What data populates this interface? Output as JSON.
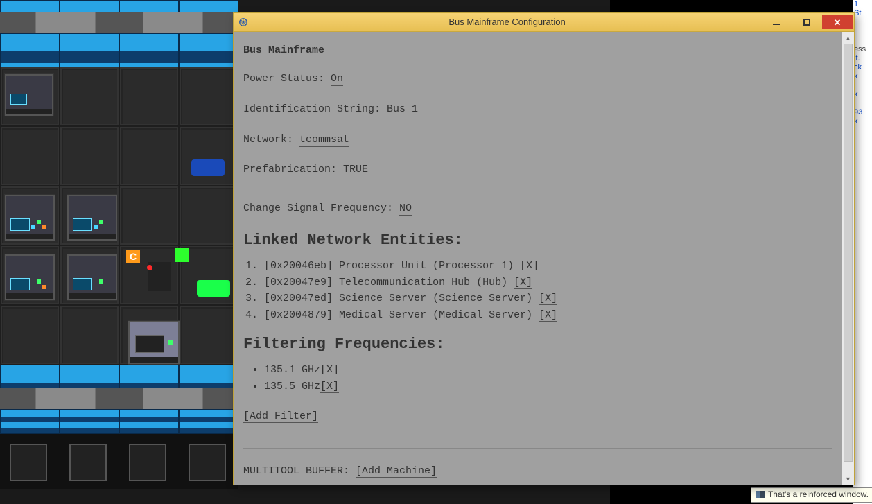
{
  "window": {
    "title": "Bus Mainframe Configuration",
    "heading": "Bus Mainframe"
  },
  "fields": {
    "power_label": "Power Status: ",
    "power_value": "On",
    "id_label": "Identification String: ",
    "id_value": "Bus 1",
    "network_label": "Network: ",
    "network_value": "tcommsat",
    "prefab_label": "Prefabrication: ",
    "prefab_value": "TRUE",
    "change_signal_label": "Change Signal Frequency: ",
    "change_signal_value": "NO"
  },
  "sections": {
    "linked_title": "Linked Network Entities:",
    "filter_title": "Filtering Frequencies:",
    "multitool_label": "MULTITOOL BUFFER: "
  },
  "entities": [
    {
      "hex": "[0x20046eb]",
      "desc": "Processor Unit (Processor 1)",
      "x": "[X]"
    },
    {
      "hex": "[0x20047e9]",
      "desc": "Telecommunication Hub (Hub)",
      "x": "[X]"
    },
    {
      "hex": "[0x20047ed]",
      "desc": "Science Server (Science Server)",
      "x": "[X]"
    },
    {
      "hex": "[0x2004879]",
      "desc": "Medical Server (Medical Server)",
      "x": "[X]"
    }
  ],
  "filters": [
    {
      "freq": "135.1 GHz",
      "x": "[X]"
    },
    {
      "freq": "135.5 GHz",
      "x": "[X]"
    }
  ],
  "buttons": {
    "add_filter": "[Add Filter]",
    "add_machine": "[Add Machine]"
  },
  "tooltip": {
    "text": "That's a reinforced window."
  },
  "hud_fragments": [
    "1",
    "St",
    "",
    "ess",
    "it.",
    "ck",
    "k",
    "",
    "k",
    "",
    "93",
    "k"
  ]
}
